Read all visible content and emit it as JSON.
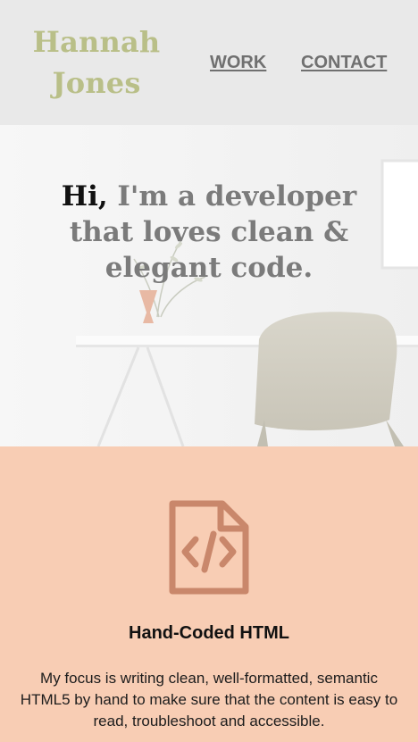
{
  "header": {
    "logo_line1": "Hannah",
    "logo_line2": "Jones",
    "nav": [
      {
        "label": "WORK"
      },
      {
        "label": "CONTACT"
      }
    ]
  },
  "hero": {
    "greeting": "Hi,",
    "headline_rest": " I'm a developer that loves clean & elegant code."
  },
  "features": [
    {
      "icon": "code-file-icon",
      "title": "Hand-Coded HTML",
      "description": "My focus is writing clean, well-formatted, semantic HTML5 by hand to make sure that the content is easy to read, troubleshoot and accessible."
    }
  ],
  "colors": {
    "header_bg": "#e9e9e9",
    "logo": "#b9bf88",
    "nav_link": "#707070",
    "hero_text": "#7b7b7b",
    "hero_greeting": "#111111",
    "features_bg": "#f8cdb4",
    "icon": "#c9876b"
  }
}
